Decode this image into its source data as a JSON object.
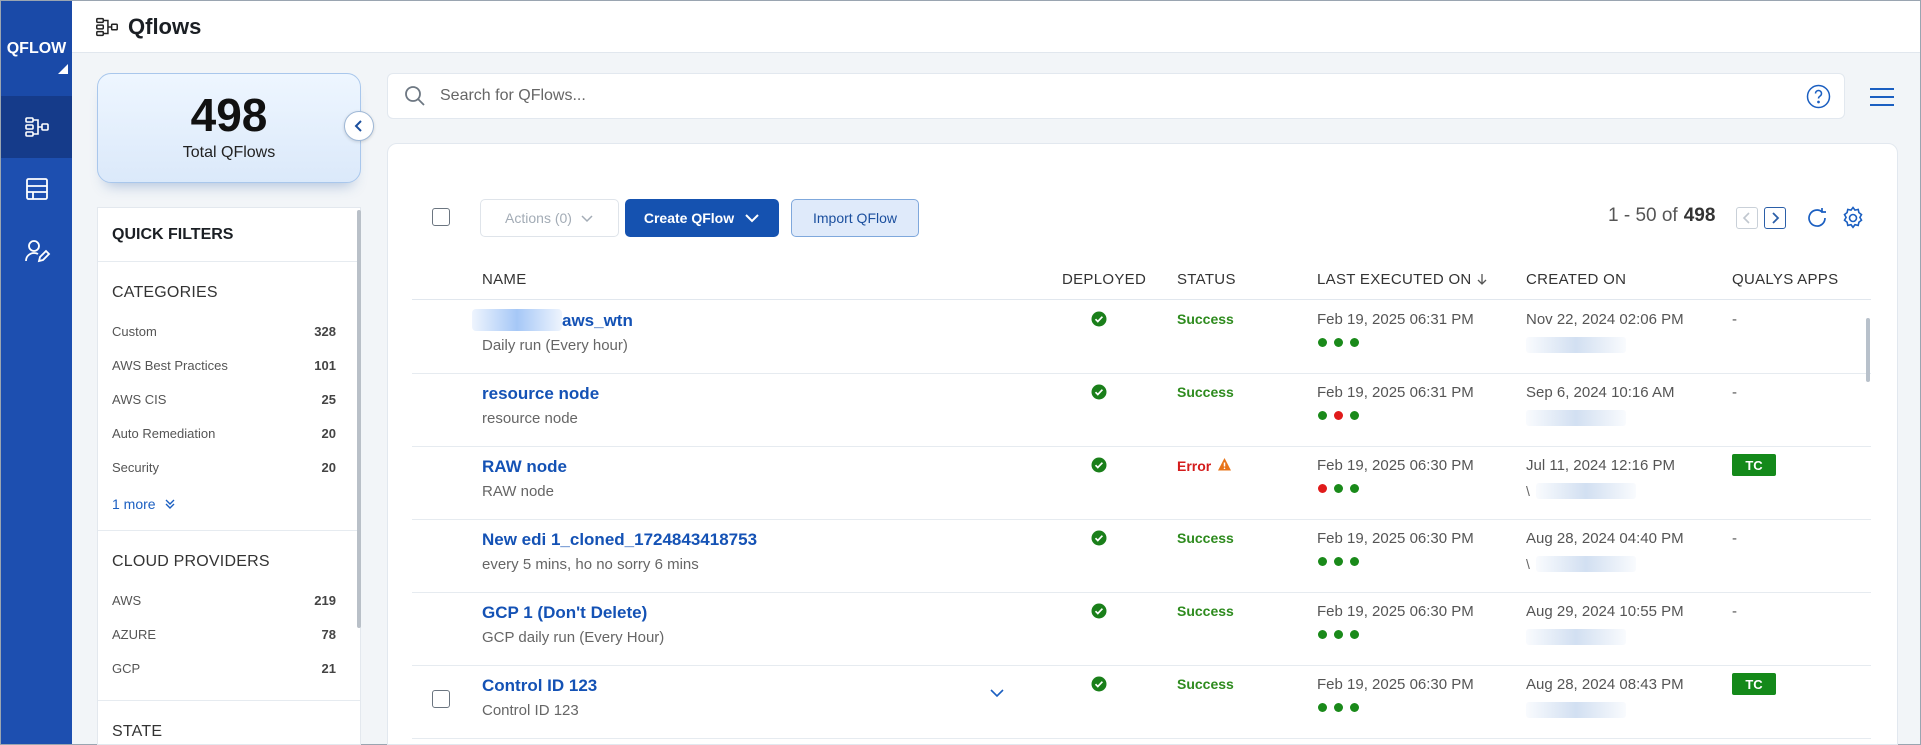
{
  "app": {
    "brand": "QFLOW",
    "title": "Qflows"
  },
  "summary": {
    "total": "498",
    "total_label": "Total QFlows"
  },
  "search": {
    "placeholder": "Search for QFlows..."
  },
  "filters": {
    "title": "QUICK FILTERS",
    "categories": {
      "title": "CATEGORIES",
      "items": [
        {
          "label": "Custom",
          "count": "328"
        },
        {
          "label": "AWS Best Practices",
          "count": "101"
        },
        {
          "label": "AWS CIS",
          "count": "25"
        },
        {
          "label": "Auto Remediation",
          "count": "20"
        },
        {
          "label": "Security",
          "count": "20"
        }
      ],
      "more": "1 more"
    },
    "cloud": {
      "title": "CLOUD PROVIDERS",
      "items": [
        {
          "label": "AWS",
          "count": "219"
        },
        {
          "label": "AZURE",
          "count": "78"
        },
        {
          "label": "GCP",
          "count": "21"
        }
      ]
    },
    "state": {
      "title": "STATE"
    }
  },
  "toolbar": {
    "actions": "Actions (0)",
    "create": "Create QFlow",
    "import": "Import QFlow",
    "range": "1 - 50 of",
    "total": "498"
  },
  "columns": {
    "name": "NAME",
    "deployed": "DEPLOYED",
    "status": "STATUS",
    "last_executed": "LAST EXECUTED ON",
    "created": "CREATED ON",
    "apps": "QUALYS APPS"
  },
  "rows": [
    {
      "name": "aws_wtn",
      "sub": "Daily run (Every hour)",
      "status": "Success",
      "executed": "Feb 19, 2025 06:31 PM",
      "created": "Nov 22, 2024 02:06 PM",
      "apps": "-"
    },
    {
      "name": "resource node",
      "sub": "resource node",
      "status": "Success",
      "executed": "Feb 19, 2025 06:31 PM",
      "created": "Sep 6, 2024 10:16 AM",
      "apps": "-"
    },
    {
      "name": "RAW node",
      "sub": "RAW node",
      "status": "Error",
      "executed": "Feb 19, 2025 06:30 PM",
      "created": "Jul 11, 2024 12:16 PM",
      "apps": "TC",
      "creator_prefix": "\\"
    },
    {
      "name": "New edi 1_cloned_1724843418753",
      "sub": "every 5 mins, ho no sorry 6 mins",
      "status": "Success",
      "executed": "Feb 19, 2025 06:30 PM",
      "created": "Aug 28, 2024 04:40 PM",
      "apps": "-",
      "creator_prefix": "\\"
    },
    {
      "name": "GCP 1 (Don't Delete)",
      "sub": "GCP daily run (Every Hour)",
      "status": "Success",
      "executed": "Feb 19, 2025 06:30 PM",
      "created": "Aug 29, 2024 10:55 PM",
      "apps": "-"
    },
    {
      "name": "Control ID 123",
      "sub": "Control ID 123",
      "status": "Success",
      "executed": "Feb 19, 2025 06:30 PM",
      "created": "Aug 28, 2024 08:43 PM",
      "apps": "TC"
    }
  ],
  "colors": {
    "success": "#2e8b1e",
    "error": "#d41c1c",
    "dot_green": "#1a8a1a",
    "dot_red": "#e01b1b",
    "brand": "#1d4fb0"
  }
}
